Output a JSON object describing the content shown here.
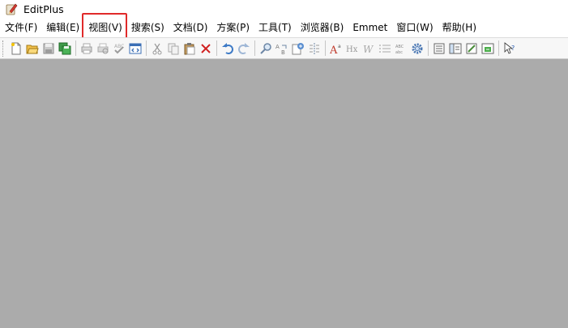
{
  "window": {
    "title": "EditPlus"
  },
  "menu": {
    "items": [
      {
        "label": "文件(F)"
      },
      {
        "label": "编辑(E)"
      },
      {
        "label": "视图(V)"
      },
      {
        "label": "搜索(S)"
      },
      {
        "label": "文档(D)"
      },
      {
        "label": "方案(P)"
      },
      {
        "label": "工具(T)"
      },
      {
        "label": "浏览器(B)"
      },
      {
        "label": "Emmet"
      },
      {
        "label": "窗口(W)"
      },
      {
        "label": "帮助(H)"
      }
    ],
    "highlighted": "视图(V)"
  },
  "toolbar": {
    "icons": [
      "new-file-icon",
      "open-folder-icon",
      "save-icon",
      "save-all-icon",
      "print-icon",
      "print-preview-icon",
      "spellcheck-icon",
      "browser-preview-icon",
      "cut-icon",
      "copy-icon",
      "paste-icon",
      "delete-icon",
      "undo-icon",
      "redo-icon",
      "find-icon",
      "replace-icon",
      "goto-icon",
      "column-marker-icon",
      "font-icon",
      "heading-icon",
      "word-wrap-icon",
      "line-number-icon",
      "ruler-icon",
      "settings-icon",
      "doc-list-icon",
      "output-window-icon",
      "cliptext-icon",
      "directory-icon",
      "help-cursor-icon"
    ]
  },
  "colors": {
    "accent_highlight": "#e02a2a",
    "workspace_bg": "#ababab",
    "toolbar_bg": "#f7f7f7"
  }
}
